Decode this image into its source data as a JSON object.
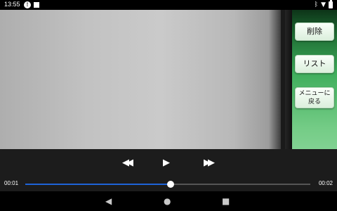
{
  "status_bar": {
    "time": "13:55",
    "notification_icons": [
      "info-icon",
      "image-icon"
    ],
    "system_icons": [
      "bluetooth-icon",
      "wifi-icon",
      "battery-icon"
    ]
  },
  "side_panel": {
    "delete_label": "削除",
    "list_label": "リスト",
    "menu_label": "メニューに\n戻る"
  },
  "controls": {
    "rewind_icon": "rewind-icon",
    "play_icon": "play-icon",
    "forward_icon": "fast-forward-icon",
    "current_time": "00:01",
    "total_time": "00:02",
    "progress": 0.51,
    "seek_color": "#1e63d8"
  },
  "nav_bar": {
    "icons": [
      "back-icon",
      "home-icon",
      "recents-icon"
    ]
  }
}
